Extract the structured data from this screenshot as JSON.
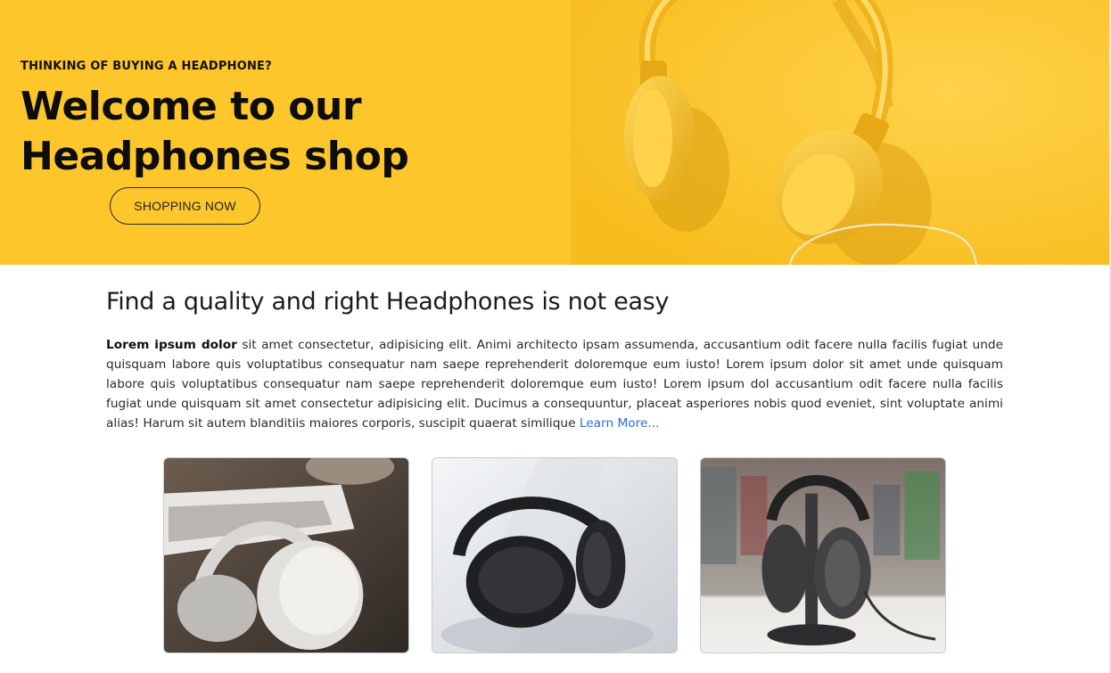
{
  "hero": {
    "eyebrow": "THINKING OF BUYING A HEADPHONE?",
    "title_line1": "Welcome to our",
    "title_line2": "Headphones shop",
    "cta_label": "SHOPPING NOW",
    "background_color": "#fdc62a",
    "image": "yellow-headphones-image"
  },
  "intro": {
    "heading": "Find a quality and right Headphones is not easy",
    "lead_bold": "Lorem ipsum dolor",
    "body": " sit amet consectetur, adipisicing elit. Animi architecto ipsam assumenda, accusantium odit facere nulla facilis fugiat unde quisquam labore quis voluptatibus consequatur nam saepe reprehenderit doloremque eum iusto! Lorem ipsum dolor sit amet unde quisquam labore quis voluptatibus consequatur nam saepe reprehenderit doloremque eum iusto! Lorem ipsum dol accusantium odit facere nulla facilis fugiat unde quisquam sit amet consectetur adipisicing elit. Ducimus a consequuntur, placeat asperiores nobis quod eveniet, sint voluptate animi alias! Harum sit autem blanditiis maiores corporis, suscipit quaerat similique ",
    "link_label": "Learn More...",
    "link_color": "#2b6fd6"
  },
  "products": [
    {
      "image": "white-sony-headphones-image"
    },
    {
      "image": "black-headphones-image"
    },
    {
      "image": "headphones-on-stand-image"
    }
  ]
}
